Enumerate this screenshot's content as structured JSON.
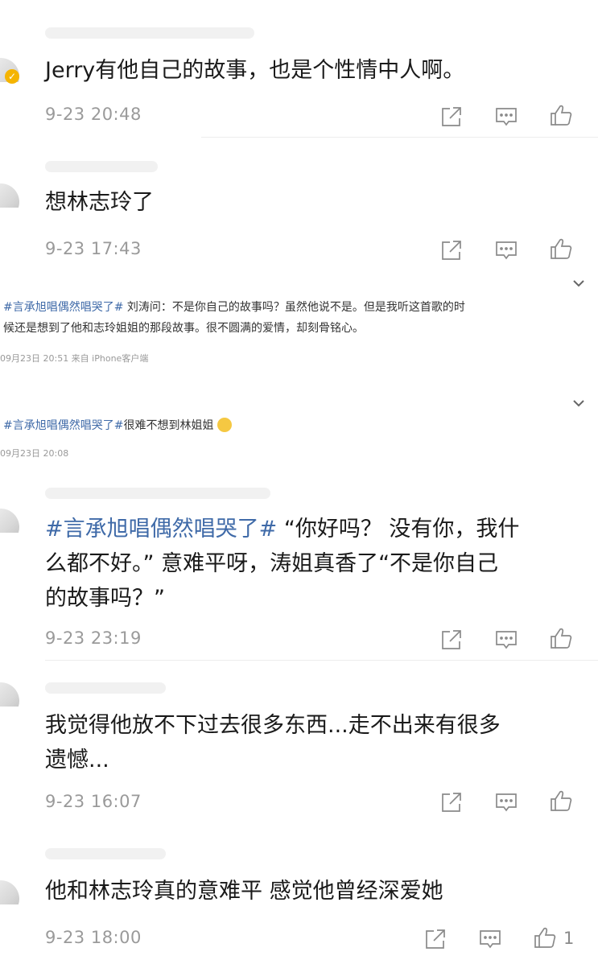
{
  "comments": [
    {
      "text": "Jerry有他自己的故事，也是个性情中人啊。",
      "time": "9-23 20:48"
    },
    {
      "text": "想林志玲了",
      "time": "9-23 17:43"
    },
    {
      "tag": "#言承旭唱偶然唱哭了#",
      "text_line1": " “你好吗？ 没有你，我什",
      "text_line2": "么都不好。” 意难平呀，涛姐真香了“不是你自己",
      "text_line3": "的故事吗？”",
      "time": "9-23 23:19"
    },
    {
      "text_line1": "我觉得他放不下过去很多东西...走不出来有很多",
      "text_line2": "遗憾...",
      "time": "9-23 16:07"
    },
    {
      "text": "他和林志玲真的意难平 感觉他曾经深爱她",
      "time": "9-23 18:00",
      "likes": "1"
    }
  ],
  "quotes": [
    {
      "tag": "#言承旭唱偶然唱哭了#",
      "line1_rest": " 刘涛问：不是你自己的故事吗？虽然他说不是。但是我听这首歌的时",
      "line2": "候还是想到了他和志玲姐姐的那段故事。很不圆满的爱情，却刻骨铭心。",
      "meta": "09月23日 20:51  来自 iPhone客户端"
    },
    {
      "tag": "#言承旭唱偶然唱哭了#",
      "rest": "很难不想到林姐姐",
      "meta": "09月23日 20:08"
    }
  ],
  "icons": {
    "share": "share-icon",
    "comment": "comment-icon",
    "like": "thumbs-up-icon"
  }
}
